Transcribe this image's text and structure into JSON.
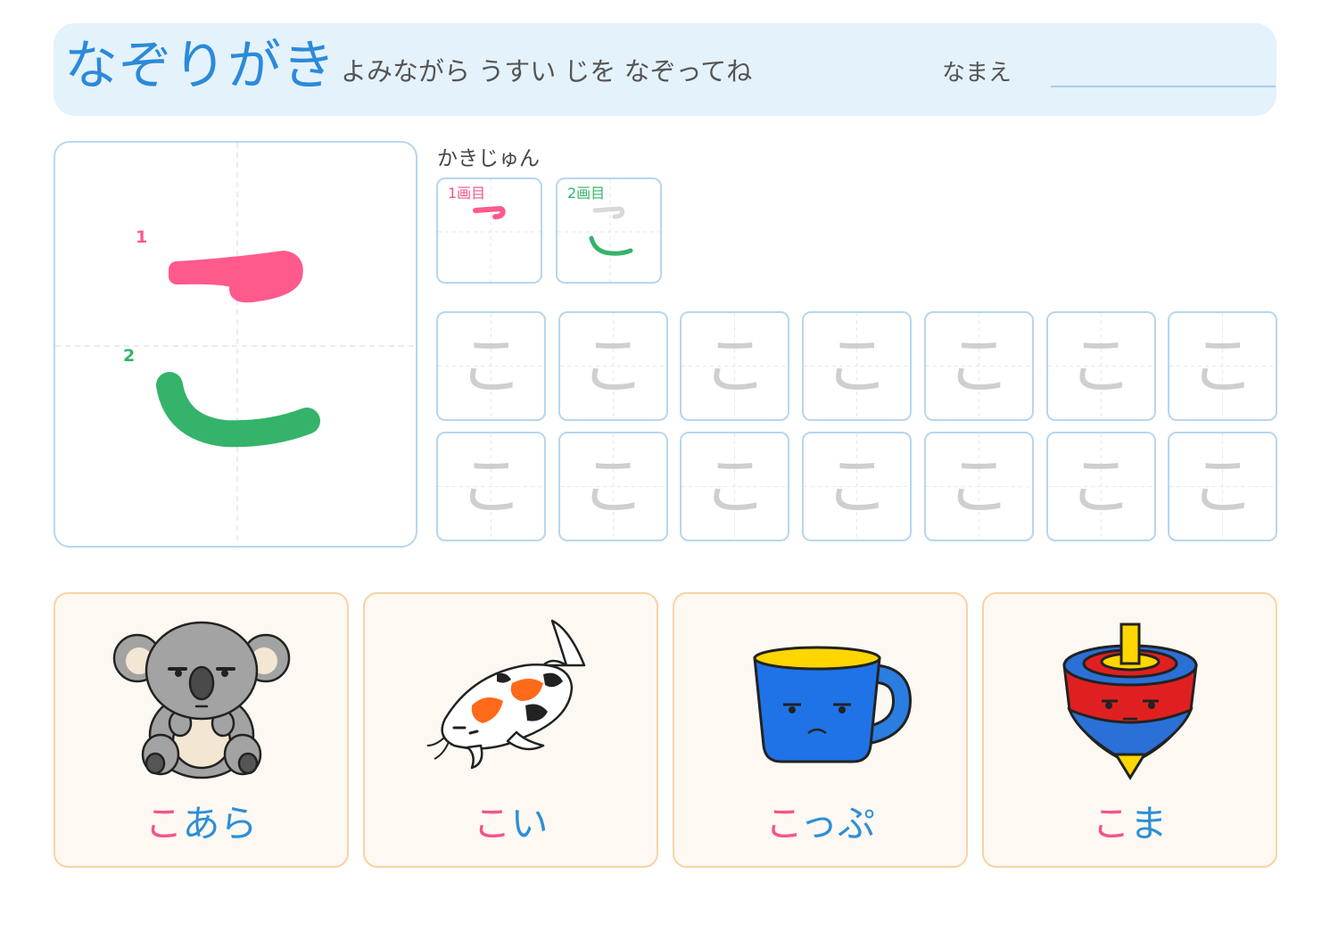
{
  "header": {
    "title": "なぞりがき",
    "subtitle": "よみながら うすい じを なぞってね",
    "name_label": "なまえ"
  },
  "character": {
    "char": "こ",
    "stroke_numbers": [
      "1",
      "2"
    ],
    "stroke_colors": [
      "#ff5a8c",
      "#35b36a"
    ]
  },
  "stroke_order": {
    "label": "かきじゅん",
    "steps": [
      {
        "label": "1画目",
        "color": "#f0568c"
      },
      {
        "label": "2画目",
        "color": "#35b36a"
      }
    ]
  },
  "practice": {
    "trace_char": "こ",
    "cells": [
      "こ",
      "こ",
      "こ",
      "こ",
      "こ",
      "こ",
      "こ",
      "こ",
      "こ",
      "こ",
      "こ",
      "こ",
      "こ",
      "こ"
    ]
  },
  "words": [
    {
      "highlight": "こ",
      "rest": "あら",
      "picture": "koala-icon"
    },
    {
      "highlight": "こ",
      "rest": "い",
      "picture": "koi-fish-icon"
    },
    {
      "highlight": "こ",
      "rest": "っぷ",
      "picture": "cup-icon"
    },
    {
      "highlight": "こ",
      "rest": "ま",
      "picture": "spinning-top-icon"
    }
  ]
}
